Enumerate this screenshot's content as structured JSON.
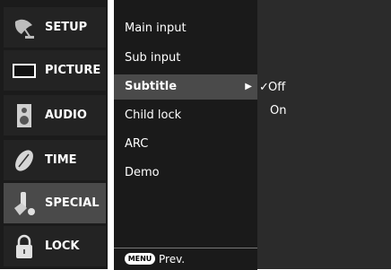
{
  "tabs": [
    {
      "label": "SETUP",
      "icon": "satellite-dish-icon",
      "active": false
    },
    {
      "label": "PICTURE",
      "icon": "tv-screen-icon",
      "active": false
    },
    {
      "label": "AUDIO",
      "icon": "speaker-icon",
      "active": false
    },
    {
      "label": "TIME",
      "icon": "clock-leaf-icon",
      "active": false
    },
    {
      "label": "SPECIAL",
      "icon": "wrench-tools-icon",
      "active": true
    },
    {
      "label": "LOCK",
      "icon": "padlock-icon",
      "active": false
    }
  ],
  "menu": {
    "items": [
      {
        "label": "Main input",
        "selected": false
      },
      {
        "label": "Sub input",
        "selected": false
      },
      {
        "label": "Subtitle",
        "selected": true
      },
      {
        "label": "Child lock",
        "selected": false
      },
      {
        "label": "ARC",
        "selected": false
      },
      {
        "label": "Demo",
        "selected": false
      }
    ],
    "footer": {
      "key_label": "MENU",
      "action_label": "Prev."
    }
  },
  "options": {
    "items": [
      {
        "label": "Off",
        "checked": true
      },
      {
        "label": "On",
        "checked": false
      }
    ]
  }
}
